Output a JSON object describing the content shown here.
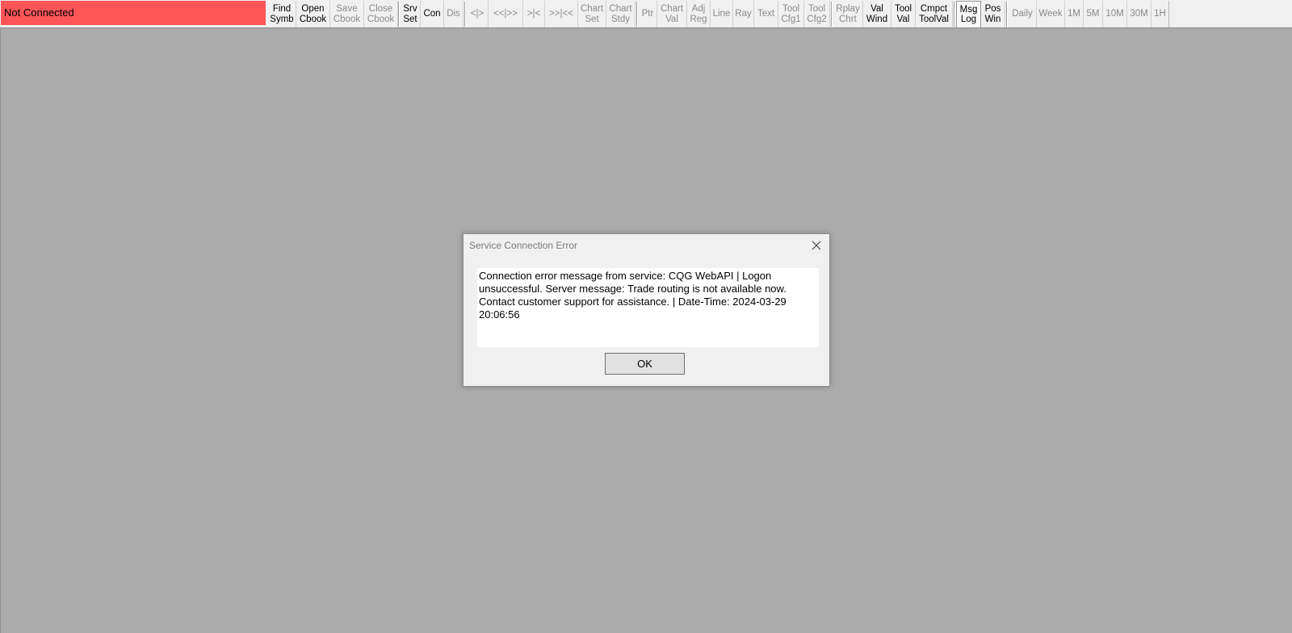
{
  "status": {
    "text": "Not Connected",
    "color": "#fe5558"
  },
  "toolbar": {
    "find_symb": "Find\nSymb",
    "open_cbook": "Open\nCbook",
    "save_cbook": "Save\nCbook",
    "close_cbook": "Close\nCbook",
    "srv_set": "Srv\nSet",
    "con": "Con",
    "dis": "Dis",
    "step_back": "<|>",
    "jump": "<<|>>",
    "to_end": ">|<",
    "fast": ">>|<<",
    "chart_set": "Chart\nSet",
    "chart_stdy": "Chart\nStdy",
    "ptr": "Ptr",
    "chart_val": "Chart\nVal",
    "adj_reg": "Adj\nReg",
    "line": "Line",
    "ray": "Ray",
    "text": "Text",
    "tool_cfg1": "Tool\nCfg1",
    "tool_cfg2": "Tool\nCfg2",
    "rplay_chrt": "Rplay\nChrt",
    "val_wind": "Val\nWind",
    "tool_val": "Tool\nVal",
    "cmpct_toolval": "Cmpct\nToolVal",
    "msg_log": "Msg\nLog",
    "pos_win": "Pos\nWin",
    "daily": "Daily",
    "week": "Week",
    "m1": "1M",
    "m5": "5M",
    "m10": "10M",
    "m30": "30M",
    "h1": "1H"
  },
  "dialog": {
    "title": "Service Connection Error",
    "message": "Connection error message from service: CQG WebAPI | Logon unsuccessful. Server message: Trade routing is not available now. Contact customer support for assistance. | Date-Time: 2024-03-29 20:06:56",
    "ok_label": "OK",
    "close_icon": "close-icon"
  }
}
